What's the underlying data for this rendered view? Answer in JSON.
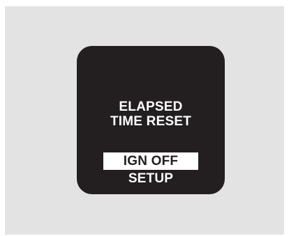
{
  "display": {
    "title_line1": "ELAPSED",
    "title_line2": "TIME RESET",
    "selected_option": "IGN OFF",
    "next_option": "SETUP"
  },
  "colors": {
    "background": "#e3e3e3",
    "screen": "#231f20",
    "text": "#ffffff",
    "highlight": "#ffffff"
  }
}
